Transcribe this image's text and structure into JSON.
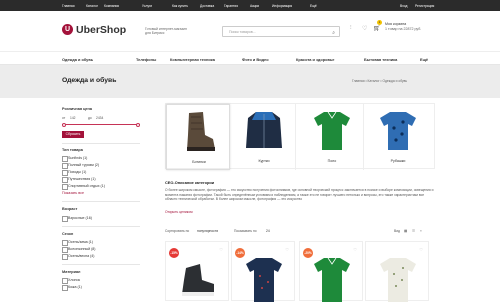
{
  "topbar": {
    "links": [
      "Главная",
      "Каталог",
      "Компания",
      "Услуги",
      "Как купить",
      "Доставка",
      "Гарантия",
      "Акции",
      "Информация",
      "Ещё"
    ],
    "right": [
      "Вход",
      "Регистрация"
    ]
  },
  "header": {
    "logo_letter": "U",
    "logo_text": "UberShop",
    "tagline": "Готовый интернет-магазин для Битрикс",
    "search_placeholder": "Поиск товаров...",
    "cart_title": "Моя корзина",
    "cart_sub": "1 товар на 22872 руб.",
    "cart_count": "1"
  },
  "nav": {
    "items": [
      "Одежда и обувь",
      "Телефоны",
      "Компьютерная техника",
      "Фото и Видео",
      "Красота и здоровье",
      "Бытовая техника",
      "Ещё"
    ]
  },
  "page": {
    "title": "Одежда и обувь",
    "breadcrumbs": "Главная  •  Каталог  •  Одежда и обувь"
  },
  "filters": {
    "price_title": "Розничная цена",
    "price_from_label": "от",
    "price_from": "142",
    "price_to_label": "до",
    "price_to": "2434",
    "reset_label": "Сбросить",
    "type_title": "Тип товара",
    "type_options": [
      "Sunfinds (1)",
      "Полный туризм (2)",
      "Походы (1)",
      "Путешествия (1)",
      "Спортивный отдых (1)"
    ],
    "show_all": "Показать все",
    "age_title": "Возраст",
    "age_options": [
      "Взрослые (16)"
    ],
    "season_title": "Сезон",
    "season_options": [
      "Осень/зима (1)",
      "Всесезонный (8)",
      "Осень/весна (4)"
    ],
    "material_title": "Материал",
    "material_options": [
      "Хлопок",
      "Кожа (1)"
    ]
  },
  "categories": [
    {
      "label": "Ботинки",
      "icon": "boot-image"
    },
    {
      "label": "Куртки",
      "icon": "jacket-image"
    },
    {
      "label": "Поло",
      "icon": "polo-image"
    },
    {
      "label": "Рубашки",
      "icon": "shirt-image"
    }
  ],
  "seo": {
    "title": "СЕО-Описание категории",
    "text": "О более широком смысле, фотография — это искусство получения фотоснимков, где основной творческий процесс заключается в поиске и выборе композиции, освещения и момента нажатия фотографии. Такой быть определённым условиям и наблюдениям, а также это не говорит лучшего нетолько и вопросы, это также характеристики все области технической обработки. В более широком смысле, фотография — это искусство",
    "more": "Открыть целиком"
  },
  "sorting": {
    "sort_label": "Сортировать по",
    "sort_value": "популярности",
    "show_label": "Показывать по",
    "show_value": "24",
    "view_label": "Вид"
  },
  "products": [
    {
      "discount": "-15%",
      "discount_color": "#e53935"
    },
    {
      "discount": "-14%",
      "discount_color": "#f06d3a"
    },
    {
      "discount": "-20%",
      "discount_color": "#f06d3a"
    },
    {
      "discount": "",
      "discount_color": ""
    }
  ],
  "colors": {
    "accent": "#a3123a",
    "topbar": "#2b2b2b",
    "band": "#ececec"
  }
}
